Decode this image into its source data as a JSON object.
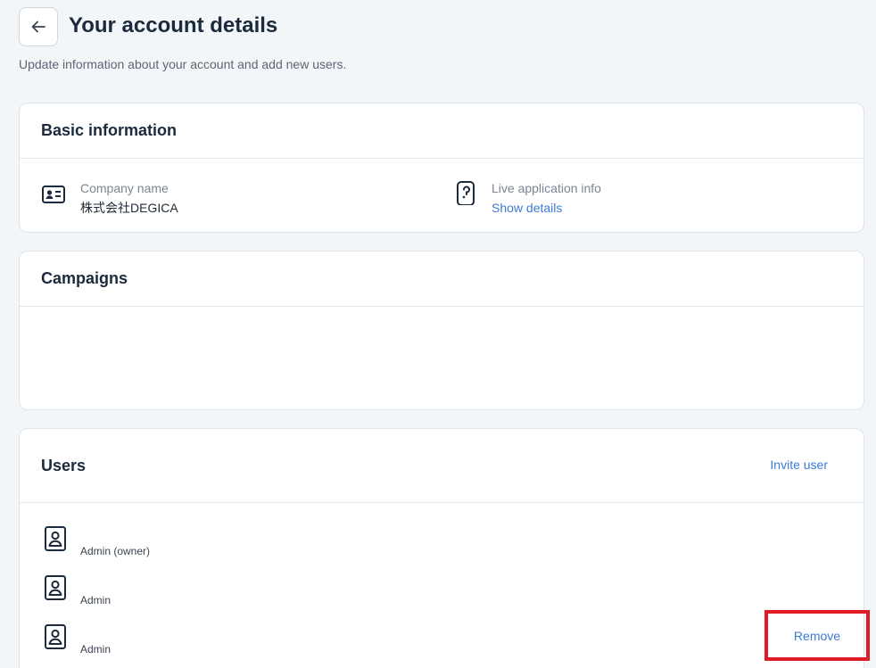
{
  "header": {
    "title": "Your account details",
    "subtitle": "Update information about your account and add new users."
  },
  "basic_info": {
    "title": "Basic information",
    "company_label": "Company name",
    "company_value": "株式会社DEGICA",
    "live_label": "Live application info",
    "live_link": "Show details"
  },
  "campaigns": {
    "title": "Campaigns"
  },
  "users": {
    "title": "Users",
    "invite_label": "Invite user",
    "rows": [
      {
        "role": "Admin (owner)"
      },
      {
        "role": "Admin"
      },
      {
        "role": "Admin"
      }
    ],
    "remove_label": "Remove"
  },
  "icons": {
    "back": "arrow-left-icon",
    "company": "id-card-icon",
    "live": "phone-app-icon",
    "user": "user-badge-icon"
  },
  "colors": {
    "link": "#3d7bd6",
    "highlight_border": "#e01c24",
    "page_bg": "#f3f6f9"
  }
}
